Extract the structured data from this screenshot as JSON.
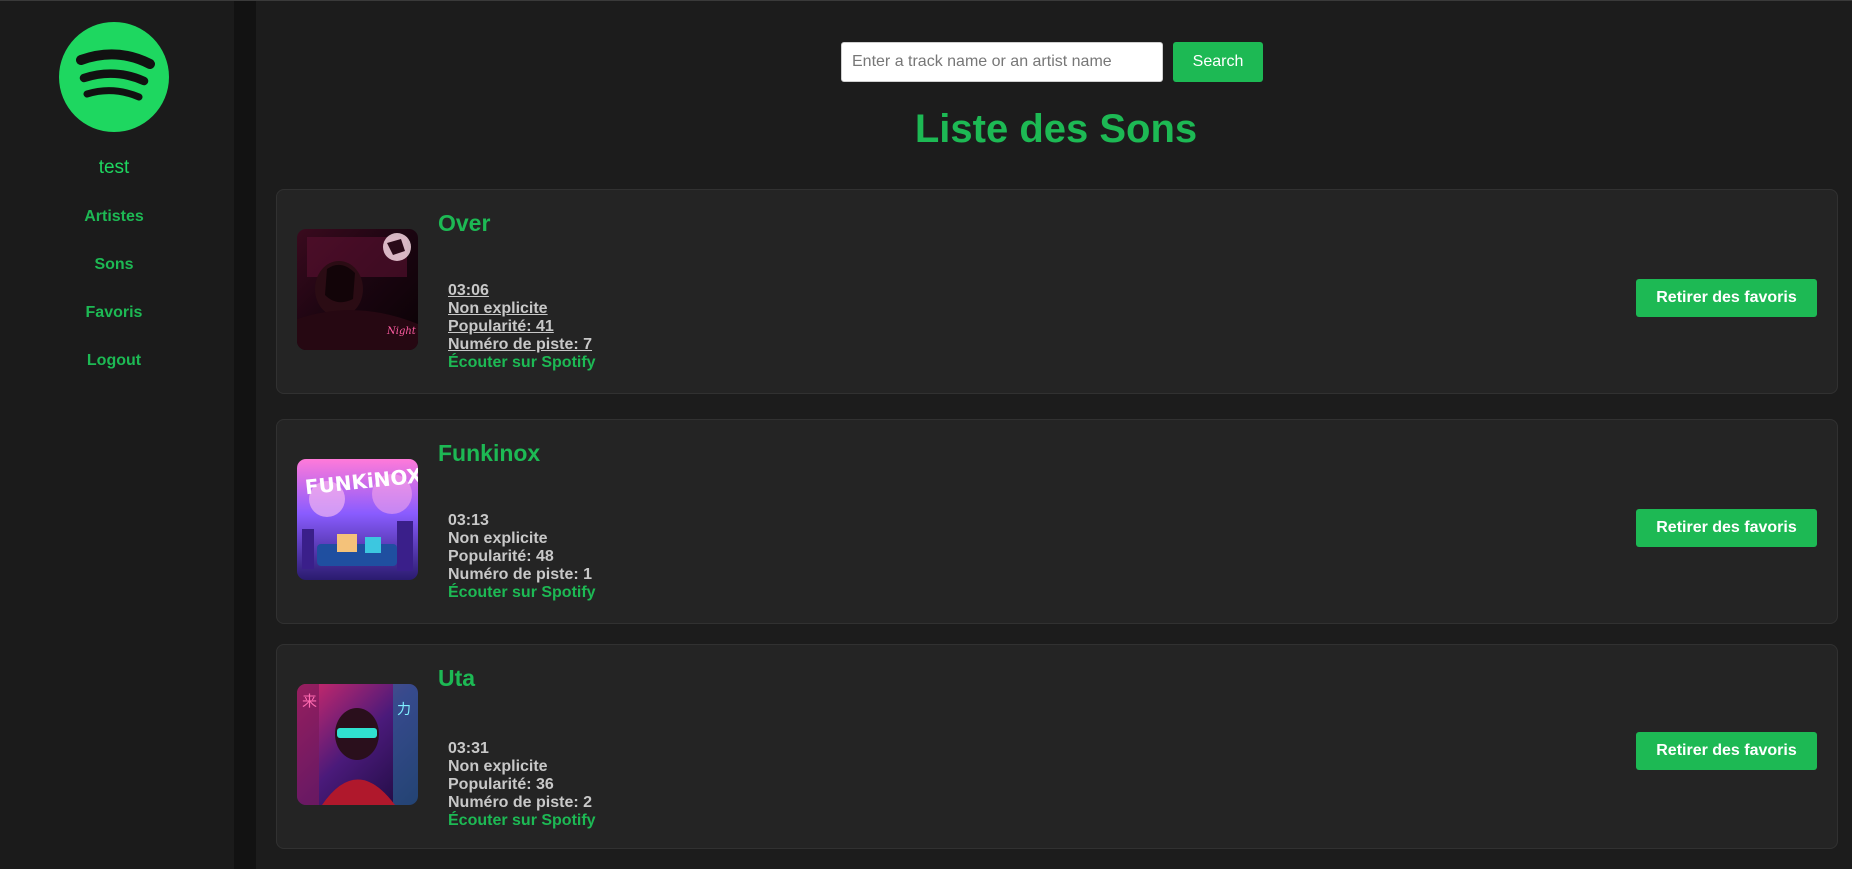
{
  "sidebar": {
    "username": "test",
    "nav": [
      {
        "label": "Artistes"
      },
      {
        "label": "Sons"
      },
      {
        "label": "Favoris"
      },
      {
        "label": "Logout"
      }
    ]
  },
  "search": {
    "placeholder": "Enter a track name or an artist name",
    "value": "",
    "button_label": "Search"
  },
  "page": {
    "title": "Liste des Sons"
  },
  "tracks": [
    {
      "name": "Over",
      "duration": "03:06",
      "explicit": "Non explicite",
      "popularity": "Popularité: 41",
      "track_number": "Numéro de piste: 7",
      "link_label": "Écouter sur Spotify",
      "remove_label": "Retirer des favoris"
    },
    {
      "name": "Funkinox",
      "duration": "03:13",
      "explicit": "Non explicite",
      "popularity": "Popularité: 48",
      "track_number": "Numéro de piste: 1",
      "link_label": "Écouter sur Spotify",
      "remove_label": "Retirer des favoris"
    },
    {
      "name": "Uta",
      "duration": "03:31",
      "explicit": "Non explicite",
      "popularity": "Popularité: 36",
      "track_number": "Numéro de piste: 2",
      "link_label": "Écouter sur Spotify",
      "remove_label": "Retirer des favoris"
    }
  ],
  "colors": {
    "accent": "#1db954",
    "background": "#1c1c1c",
    "card": "#242424"
  }
}
